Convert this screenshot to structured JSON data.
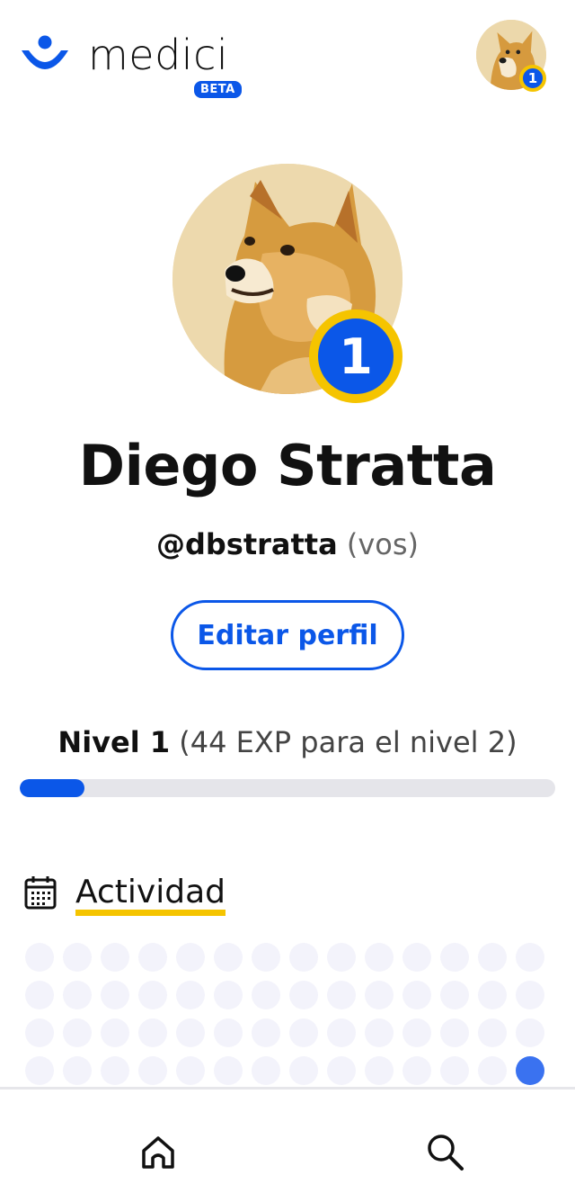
{
  "app": {
    "logo_text": "medici",
    "beta_label": "BETA"
  },
  "header": {
    "avatar_level": "1"
  },
  "profile": {
    "level_badge": "1",
    "name": "Diego Stratta",
    "handle": "@dbstratta",
    "handle_note": " (vos)",
    "edit_label": "Editar perfil"
  },
  "level": {
    "label": "Nivel 1",
    "note": " (44 EXP para el nivel 2)",
    "progress_fraction": 0.12
  },
  "activity": {
    "title": "Actividad",
    "rows": 4,
    "columns": 14,
    "active_cells": [
      [
        3,
        13
      ]
    ]
  },
  "nav": {
    "items": [
      "home-icon",
      "search-icon"
    ]
  },
  "colors": {
    "primary": "#0b57e8",
    "accent": "#f5c400",
    "track": "#e5e5ea"
  }
}
